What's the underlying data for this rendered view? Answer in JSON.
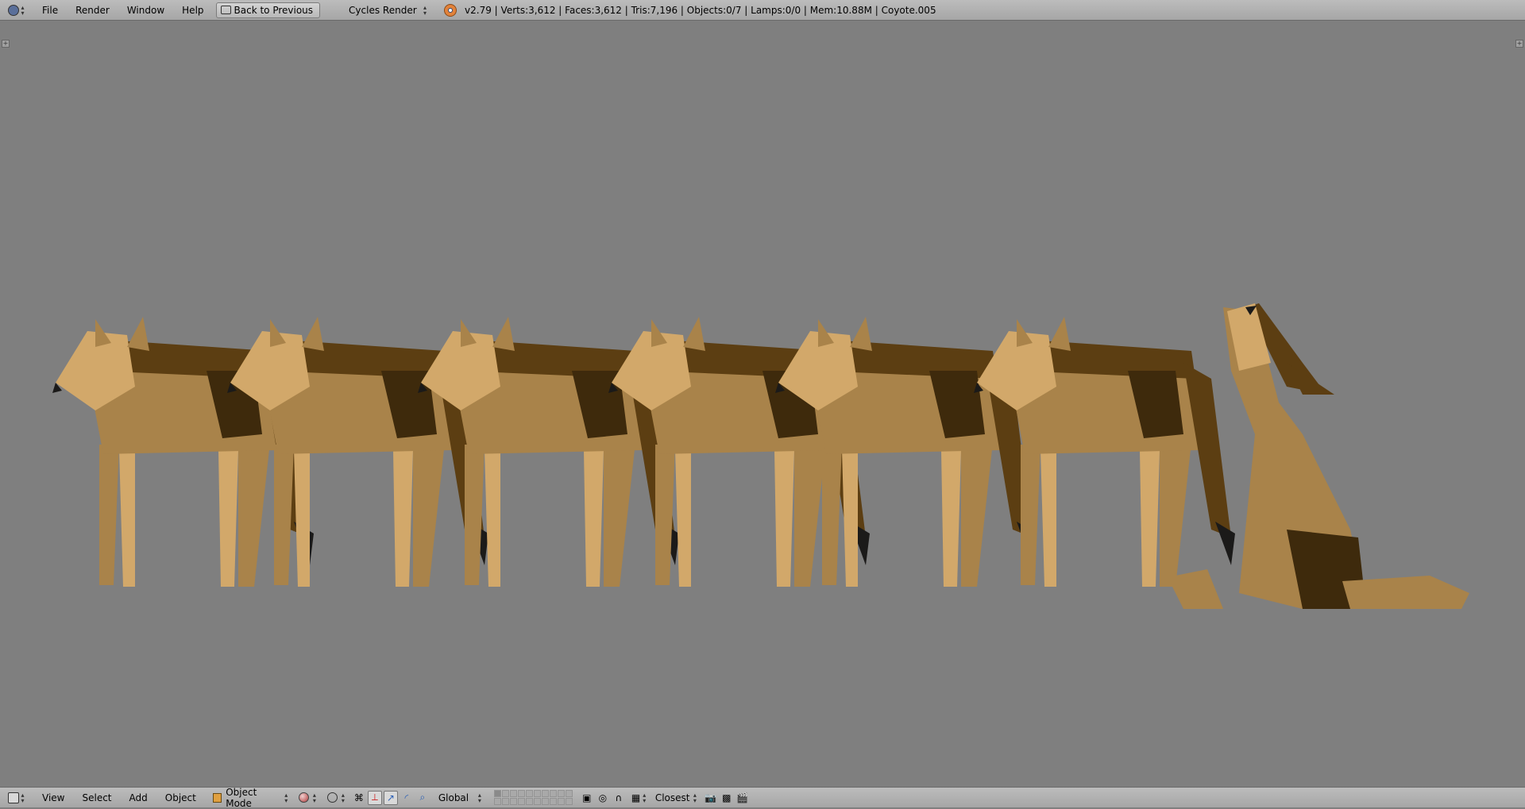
{
  "topbar": {
    "menus": [
      "File",
      "Render",
      "Window",
      "Help"
    ],
    "back_button": "Back to Previous",
    "engine": "Cycles Render",
    "stats": "v2.79 | Verts:3,612 | Faces:3,612 | Tris:7,196 | Objects:0/7 | Lamps:0/0 | Mem:10.88M | Coyote.005"
  },
  "bottombar": {
    "menus": [
      "View",
      "Select",
      "Add",
      "Object"
    ],
    "mode": "Object Mode",
    "orientation": "Global",
    "snap_target": "Closest"
  },
  "viewport": {
    "background": "#7f7f7f",
    "object_colors": {
      "light": "#d2a86a",
      "mid": "#a9834a",
      "dark": "#5c3e12",
      "shadow": "#3e2a0c",
      "tip": "#1b1a19"
    }
  }
}
